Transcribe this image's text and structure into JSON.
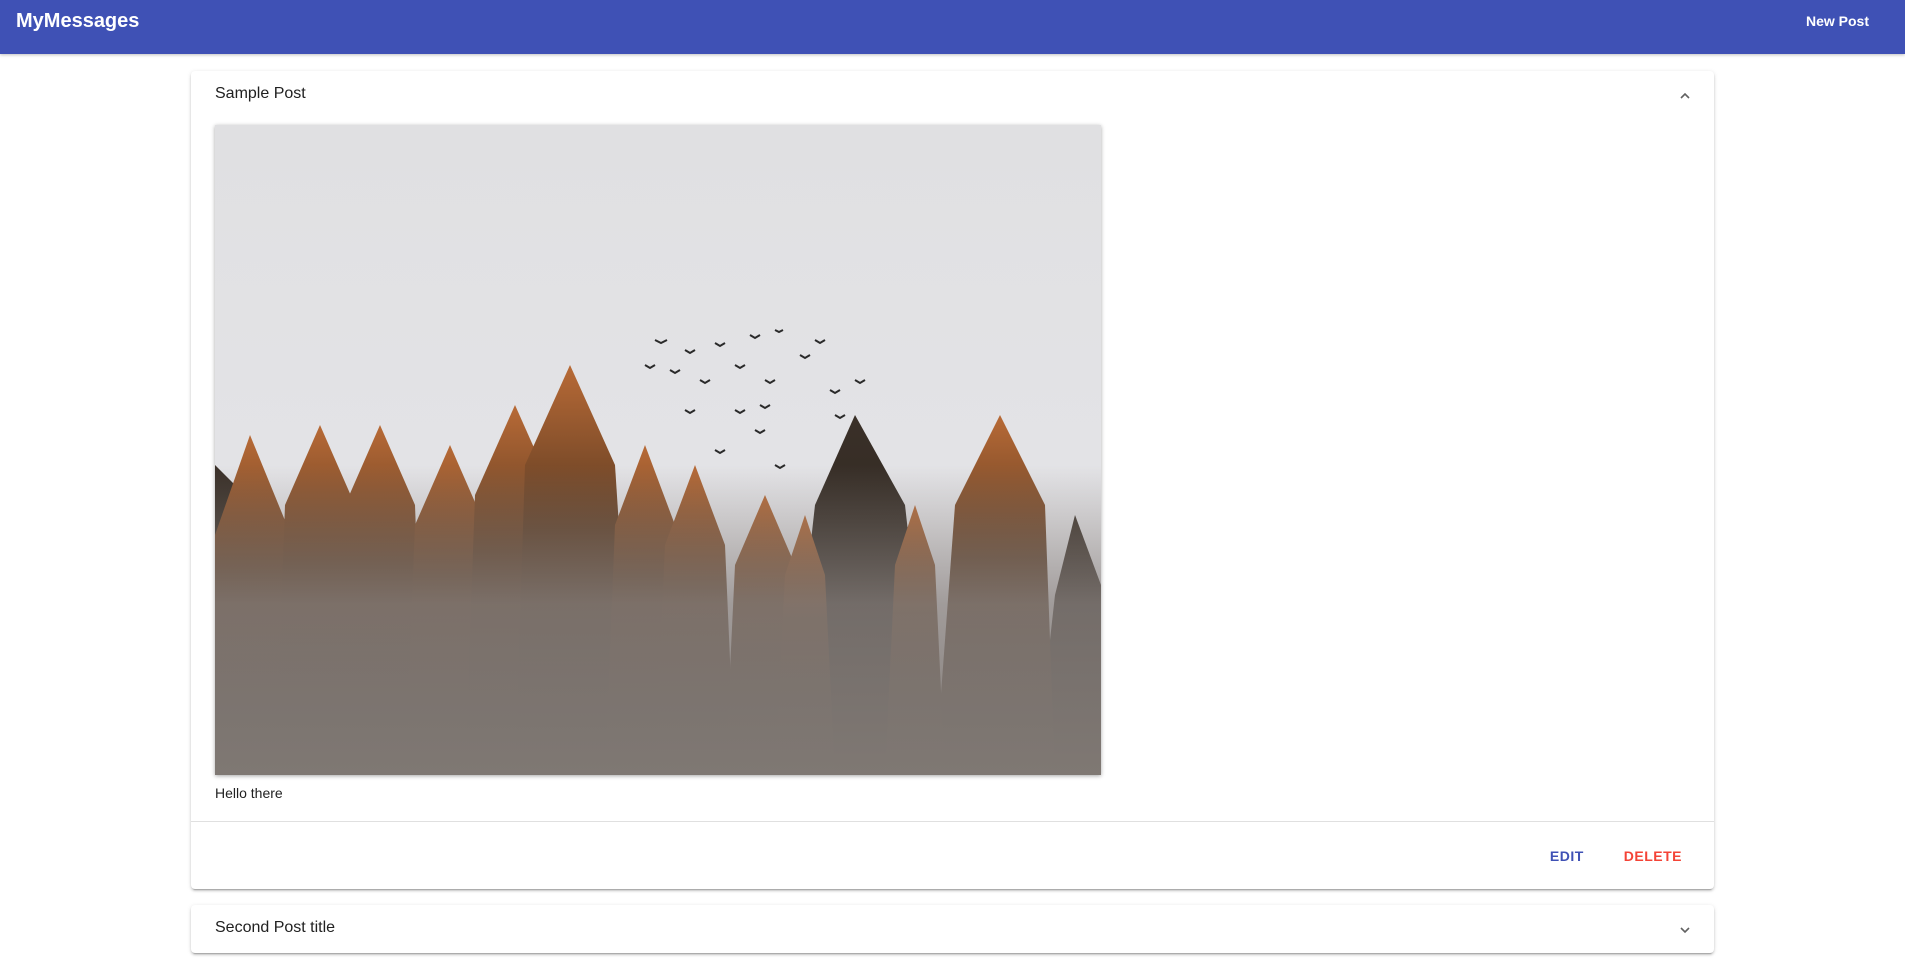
{
  "app": {
    "title": "MyMessages",
    "new_post_label": "New Post"
  },
  "colors": {
    "primary": "#3f51b5",
    "warn": "#f44336"
  },
  "posts": [
    {
      "title": "Sample Post",
      "expanded": true,
      "content": "Hello there",
      "image_description": "foggy pine forest with flock of birds",
      "actions": {
        "edit_label": "EDIT",
        "delete_label": "DELETE"
      }
    },
    {
      "title": "Second Post title",
      "expanded": false
    }
  ]
}
